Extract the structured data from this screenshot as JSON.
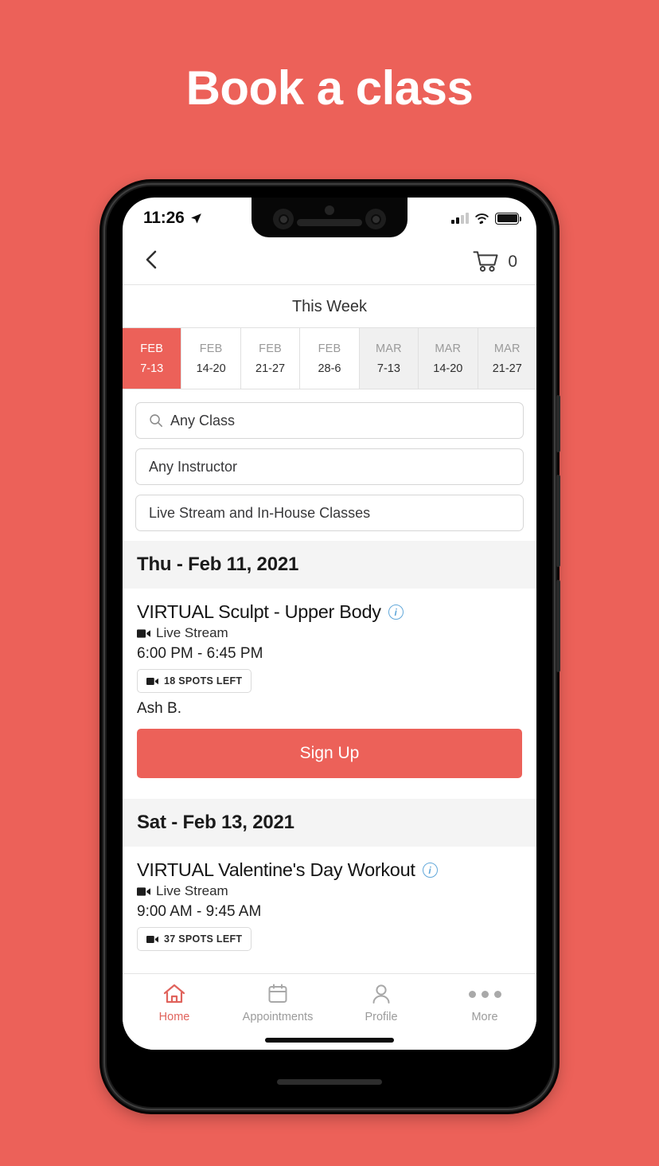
{
  "page": {
    "title": "Book a class",
    "background_color": "#ec6159",
    "accent_color": "#ec6159"
  },
  "status_bar": {
    "time": "11:26",
    "location_icon": "location-arrow-icon",
    "signal_icon": "cellular-signal-icon",
    "wifi_icon": "wifi-icon",
    "battery_icon": "battery-full-icon"
  },
  "app_bar": {
    "back_icon": "chevron-left-icon",
    "cart_icon": "shopping-cart-icon",
    "cart_count": "0"
  },
  "week_nav": {
    "label": "This Week",
    "weeks": [
      {
        "month": "FEB",
        "range": "7-13",
        "state": "active"
      },
      {
        "month": "FEB",
        "range": "14-20",
        "state": "normal"
      },
      {
        "month": "FEB",
        "range": "21-27",
        "state": "normal"
      },
      {
        "month": "FEB",
        "range": "28-6",
        "state": "normal"
      },
      {
        "month": "MAR",
        "range": "7-13",
        "state": "dim"
      },
      {
        "month": "MAR",
        "range": "14-20",
        "state": "dim"
      },
      {
        "month": "MAR",
        "range": "21-27",
        "state": "dim"
      }
    ]
  },
  "filters": {
    "class_value": "Any Class",
    "class_icon": "search-icon",
    "instructor_value": "Any Instructor",
    "type_value": "Live Stream and In-House Classes"
  },
  "schedule": [
    {
      "day_header": "Thu - Feb 11, 2021",
      "classes": [
        {
          "title": "VIRTUAL Sculpt - Upper Body",
          "info_icon": "info-circle-icon",
          "stream_icon": "video-camera-icon",
          "stream_label": "Live Stream",
          "time": "6:00 PM - 6:45 PM",
          "spots_icon": "video-camera-icon",
          "spots_label": "18 SPOTS LEFT",
          "instructor": "Ash B.",
          "action_label": "Sign Up"
        }
      ]
    },
    {
      "day_header": "Sat - Feb 13, 2021",
      "classes": [
        {
          "title": "VIRTUAL Valentine's Day Workout",
          "info_icon": "info-circle-icon",
          "stream_icon": "video-camera-icon",
          "stream_label": "Live Stream",
          "time": "9:00 AM - 9:45 AM",
          "spots_icon": "video-camera-icon",
          "spots_label": "37 SPOTS LEFT",
          "instructor": "",
          "action_label": ""
        }
      ]
    }
  ],
  "tab_bar": {
    "tabs": [
      {
        "label": "Home",
        "icon": "home-icon",
        "active": true
      },
      {
        "label": "Appointments",
        "icon": "calendar-icon",
        "active": false
      },
      {
        "label": "Profile",
        "icon": "person-icon",
        "active": false
      },
      {
        "label": "More",
        "icon": "ellipsis-icon",
        "active": false
      }
    ]
  }
}
